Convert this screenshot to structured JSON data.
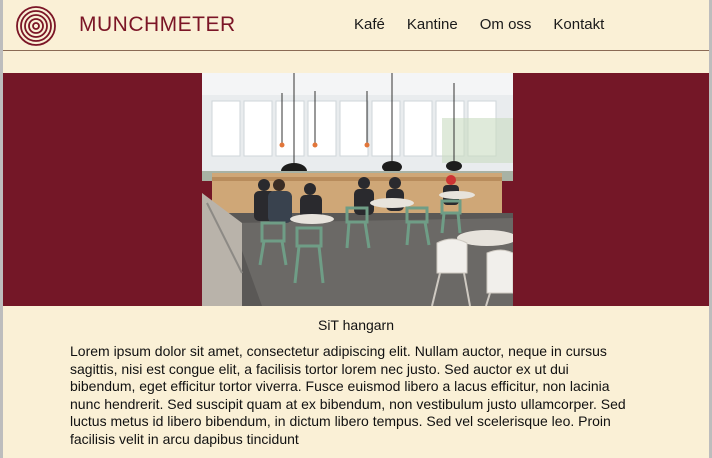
{
  "header": {
    "brand": "MUNCHMETER",
    "logo_icon": "concentric-circles-icon",
    "brand_color": "#7b1526"
  },
  "nav": {
    "items": [
      {
        "label": "Kafé"
      },
      {
        "label": "Kantine"
      },
      {
        "label": "Om oss"
      },
      {
        "label": "Kontakt"
      }
    ]
  },
  "hero": {
    "banner_color": "#741727",
    "image_subject": "cafeteria-interior-photo"
  },
  "content": {
    "caption": "SiT hangarn",
    "paragraph": "Lorem ipsum dolor sit amet, consectetur adipiscing elit. Nullam auctor, neque in cursus sagittis, nisi est congue elit, a facilisis tortor lorem nec justo. Sed auctor ex ut dui bibendum, eget efficitur tortor viverra. Fusce euismod libero a lacus efficitur, non lacinia nunc hendrerit. Sed suscipit quam at ex bibendum, non vestibulum justo ullamcorper. Sed luctus metus id libero bibendum, in dictum libero tempus. Sed vel scelerisque leo. Proin facilisis velit in arcu dapibus tincidunt"
  },
  "colors": {
    "page_background": "#faf0d6",
    "accent": "#741727"
  }
}
